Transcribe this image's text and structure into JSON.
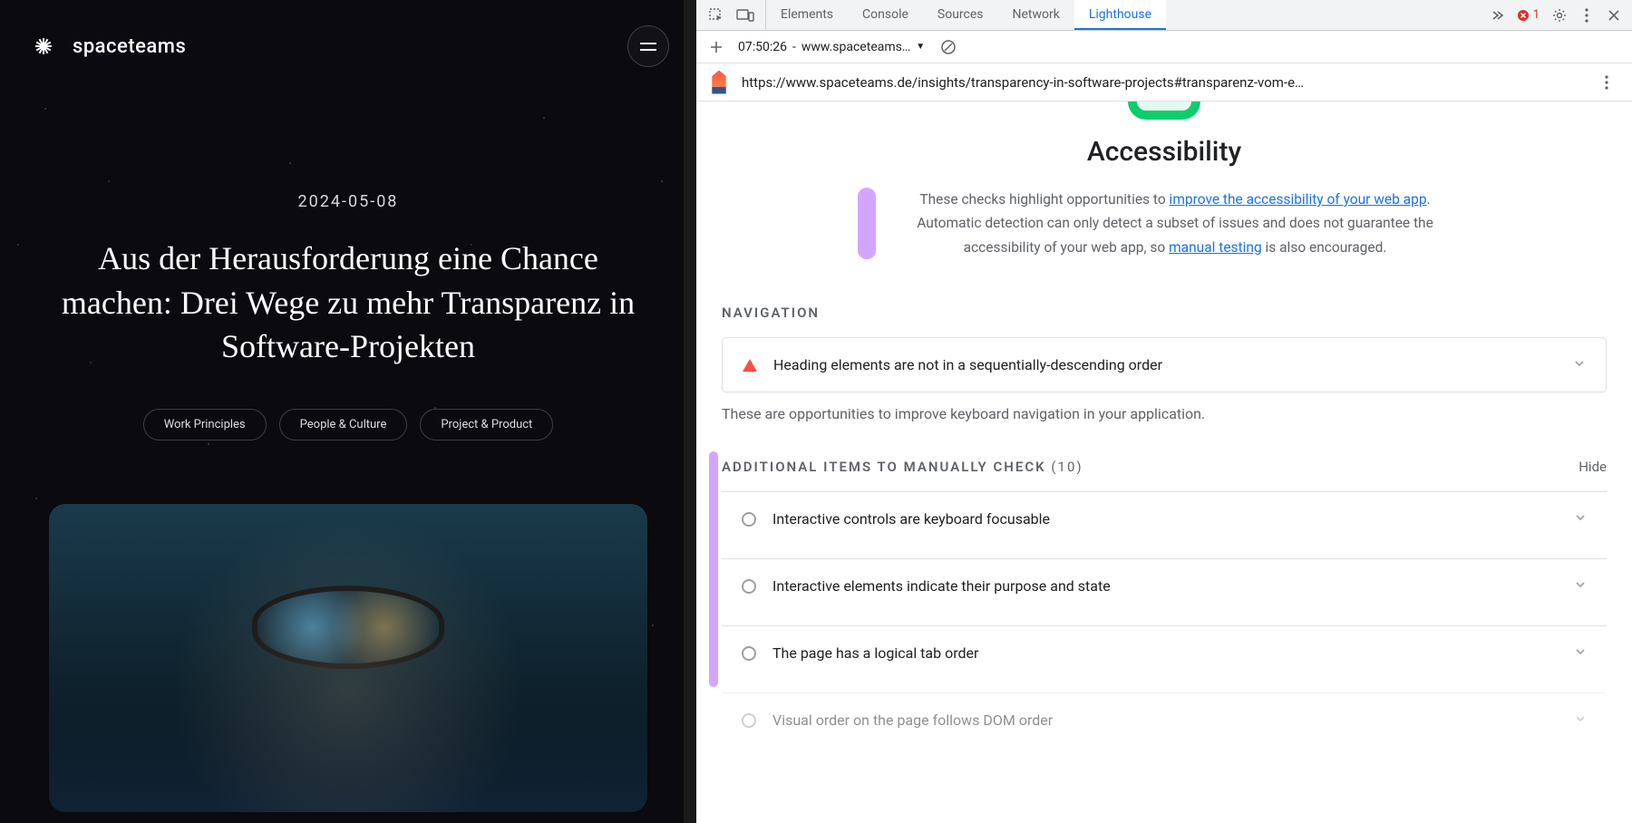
{
  "site": {
    "brand": "spaceteams",
    "date": "2024-05-08",
    "headline": "Aus der Herausforderung eine Chance machen: Drei Wege zu mehr Transparenz in Software-Projekten",
    "tags": [
      "Work Principles",
      "People & Culture",
      "Project & Product"
    ]
  },
  "devtools": {
    "tabs": [
      "Elements",
      "Console",
      "Sources",
      "Network",
      "Lighthouse"
    ],
    "active_tab": "Lighthouse",
    "errors": "1",
    "secondary": {
      "timestamp": "07:50:26",
      "host": "www.spaceteams…"
    },
    "url": "https://www.spaceteams.de/insights/transparency-in-software-projects#transparenz-vom-e…",
    "report": {
      "title": "Accessibility",
      "desc_pre": "These checks highlight opportunities to ",
      "desc_link1": "improve the accessibility of your web app",
      "desc_mid": ". Automatic detection can only detect a subset of issues and does not guarantee the accessibility of your web app, so ",
      "desc_link2": "manual testing",
      "desc_post": " is also encouraged.",
      "nav_label": "NAVIGATION",
      "nav_audit": "Heading elements are not in a sequentially-descending order",
      "nav_note": "These are opportunities to improve keyboard navigation in your application.",
      "manual_label": "ADDITIONAL ITEMS TO MANUALLY CHECK",
      "manual_count": "(10)",
      "hide": "Hide",
      "manual_items": [
        "Interactive controls are keyboard focusable",
        "Interactive elements indicate their purpose and state",
        "The page has a logical tab order",
        "Visual order on the page follows DOM order"
      ]
    }
  }
}
